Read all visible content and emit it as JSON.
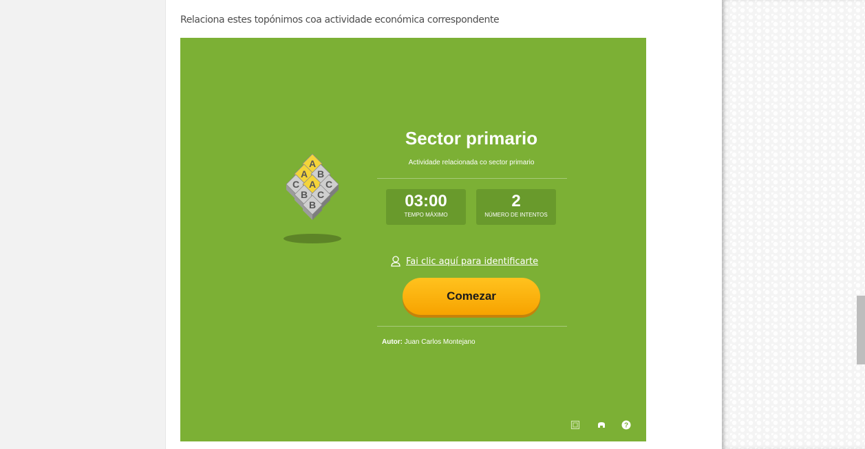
{
  "page": {
    "instruction": "Relaciona estes topónimos coa actividade económica correspondente"
  },
  "activity": {
    "logo_letters": [
      "A",
      "A",
      "B",
      "A",
      "C",
      "C",
      "B",
      "C",
      "B"
    ],
    "title": "Sector primario",
    "subtitle": "Actividade relacionada co sector primario",
    "stats": {
      "time_value": "03:00",
      "time_label": "TEMPO MÁXIMO",
      "attempts_value": "2",
      "attempts_label": "NÚMERO DE INTENTOS"
    },
    "login_text": "Fai clic aquí para identificarte",
    "start_label": "Comezar",
    "author_label": "Autor:",
    "author_name": "Juan Carlos Montejano",
    "toolbar_icons": [
      "fullscreen-icon",
      "embed-icon",
      "help-icon"
    ]
  },
  "colors": {
    "activity_bg": "#7cb035",
    "stat_box": "#699a2c",
    "start_button": "#f9ad00",
    "logo_tile_yellow": "#f4d43a",
    "logo_tile_grey": "#cfcfcf"
  }
}
